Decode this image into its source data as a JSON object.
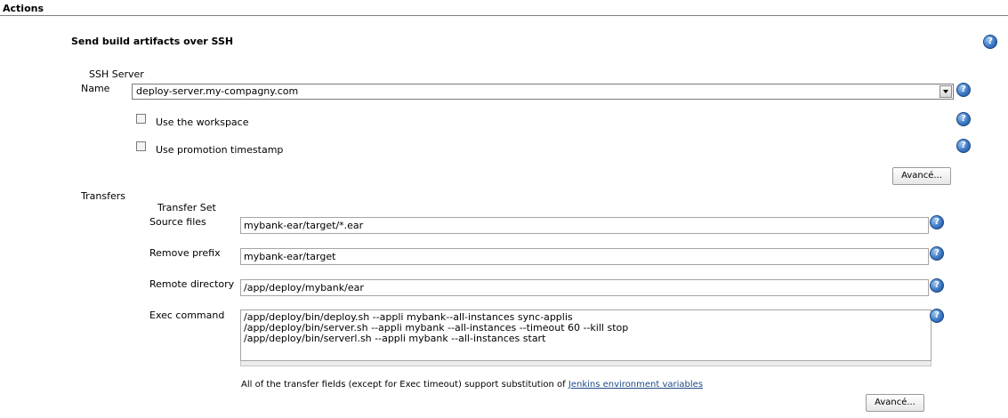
{
  "section": {
    "title": "Actions"
  },
  "publisher": {
    "title": "Send build artifacts over SSH"
  },
  "ssh_server": {
    "heading": "SSH Server",
    "name_label": "Name",
    "name_value": "deploy-server.my-compagny.com",
    "use_workspace_label": "Use the workspace",
    "use_promotion_timestamp_label": "Use promotion timestamp",
    "advanced_button": "Avancé..."
  },
  "transfers": {
    "heading": "Transfers",
    "set_heading": "Transfer Set",
    "source_files_label": "Source files",
    "source_files_value": "mybank-ear/target/*.ear",
    "remove_prefix_label": "Remove prefix",
    "remove_prefix_value": "mybank-ear/target",
    "remote_directory_label": "Remote directory",
    "remote_directory_value": "/app/deploy/mybank/ear",
    "exec_command_label": "Exec command",
    "exec_command_value": "/app/deploy/bin/deploy.sh --appli mybank--all-instances sync-applis\n/app/deploy/bin/server.sh --appli mybank --all-instances --timeout 60 --kill stop\n/app/deploy/bin/serverl.sh --appli mybank --all-instances start",
    "note_text": "All of the transfer fields (except for Exec timeout) support substitution of ",
    "note_link": "Jenkins environment variables",
    "advanced_button": "Avancé..."
  },
  "help_icon_glyph": "?",
  "colors": {
    "help": "#3b78c4",
    "link": "#204a87",
    "border": "#a5a5a5"
  }
}
